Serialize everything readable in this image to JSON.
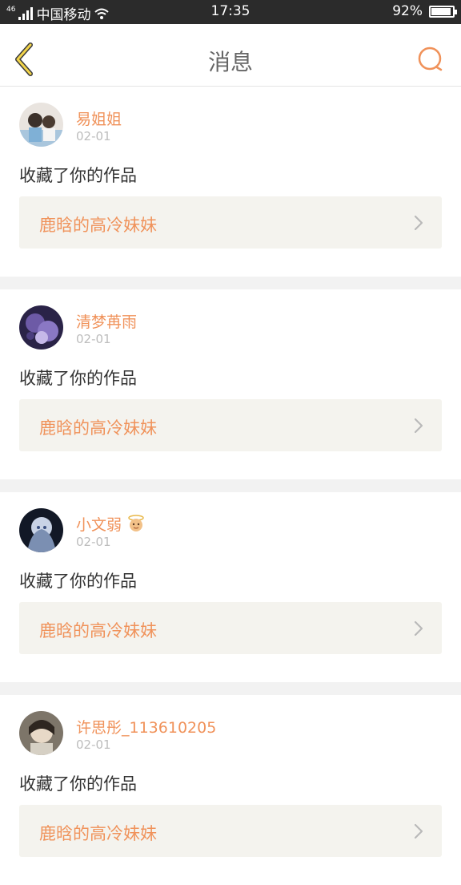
{
  "status_bar": {
    "network": "46",
    "carrier": "中国移动",
    "time": "17:35",
    "battery_percent": "92%",
    "battery_level": 0.92
  },
  "header": {
    "title": "消息",
    "back_icon": "back-chevron-icon",
    "search_icon": "search-icon",
    "accent_color": "#f0925a"
  },
  "messages": [
    {
      "username": "易姐姐",
      "date": "02-01",
      "action": "收藏了你的作品",
      "work_title": "鹿晗的高冷妹妹"
    },
    {
      "username": "清梦苒雨",
      "date": "02-01",
      "action": "收藏了你的作品",
      "work_title": "鹿晗的高冷妹妹"
    },
    {
      "username": "小文弱",
      "date": "02-01",
      "action": "收藏了你的作品",
      "work_title": "鹿晗的高冷妹妹"
    },
    {
      "username": "许思彤_113610205",
      "date": "02-01",
      "action": "收藏了你的作品",
      "work_title": "鹿晗的高冷妹妹"
    }
  ]
}
